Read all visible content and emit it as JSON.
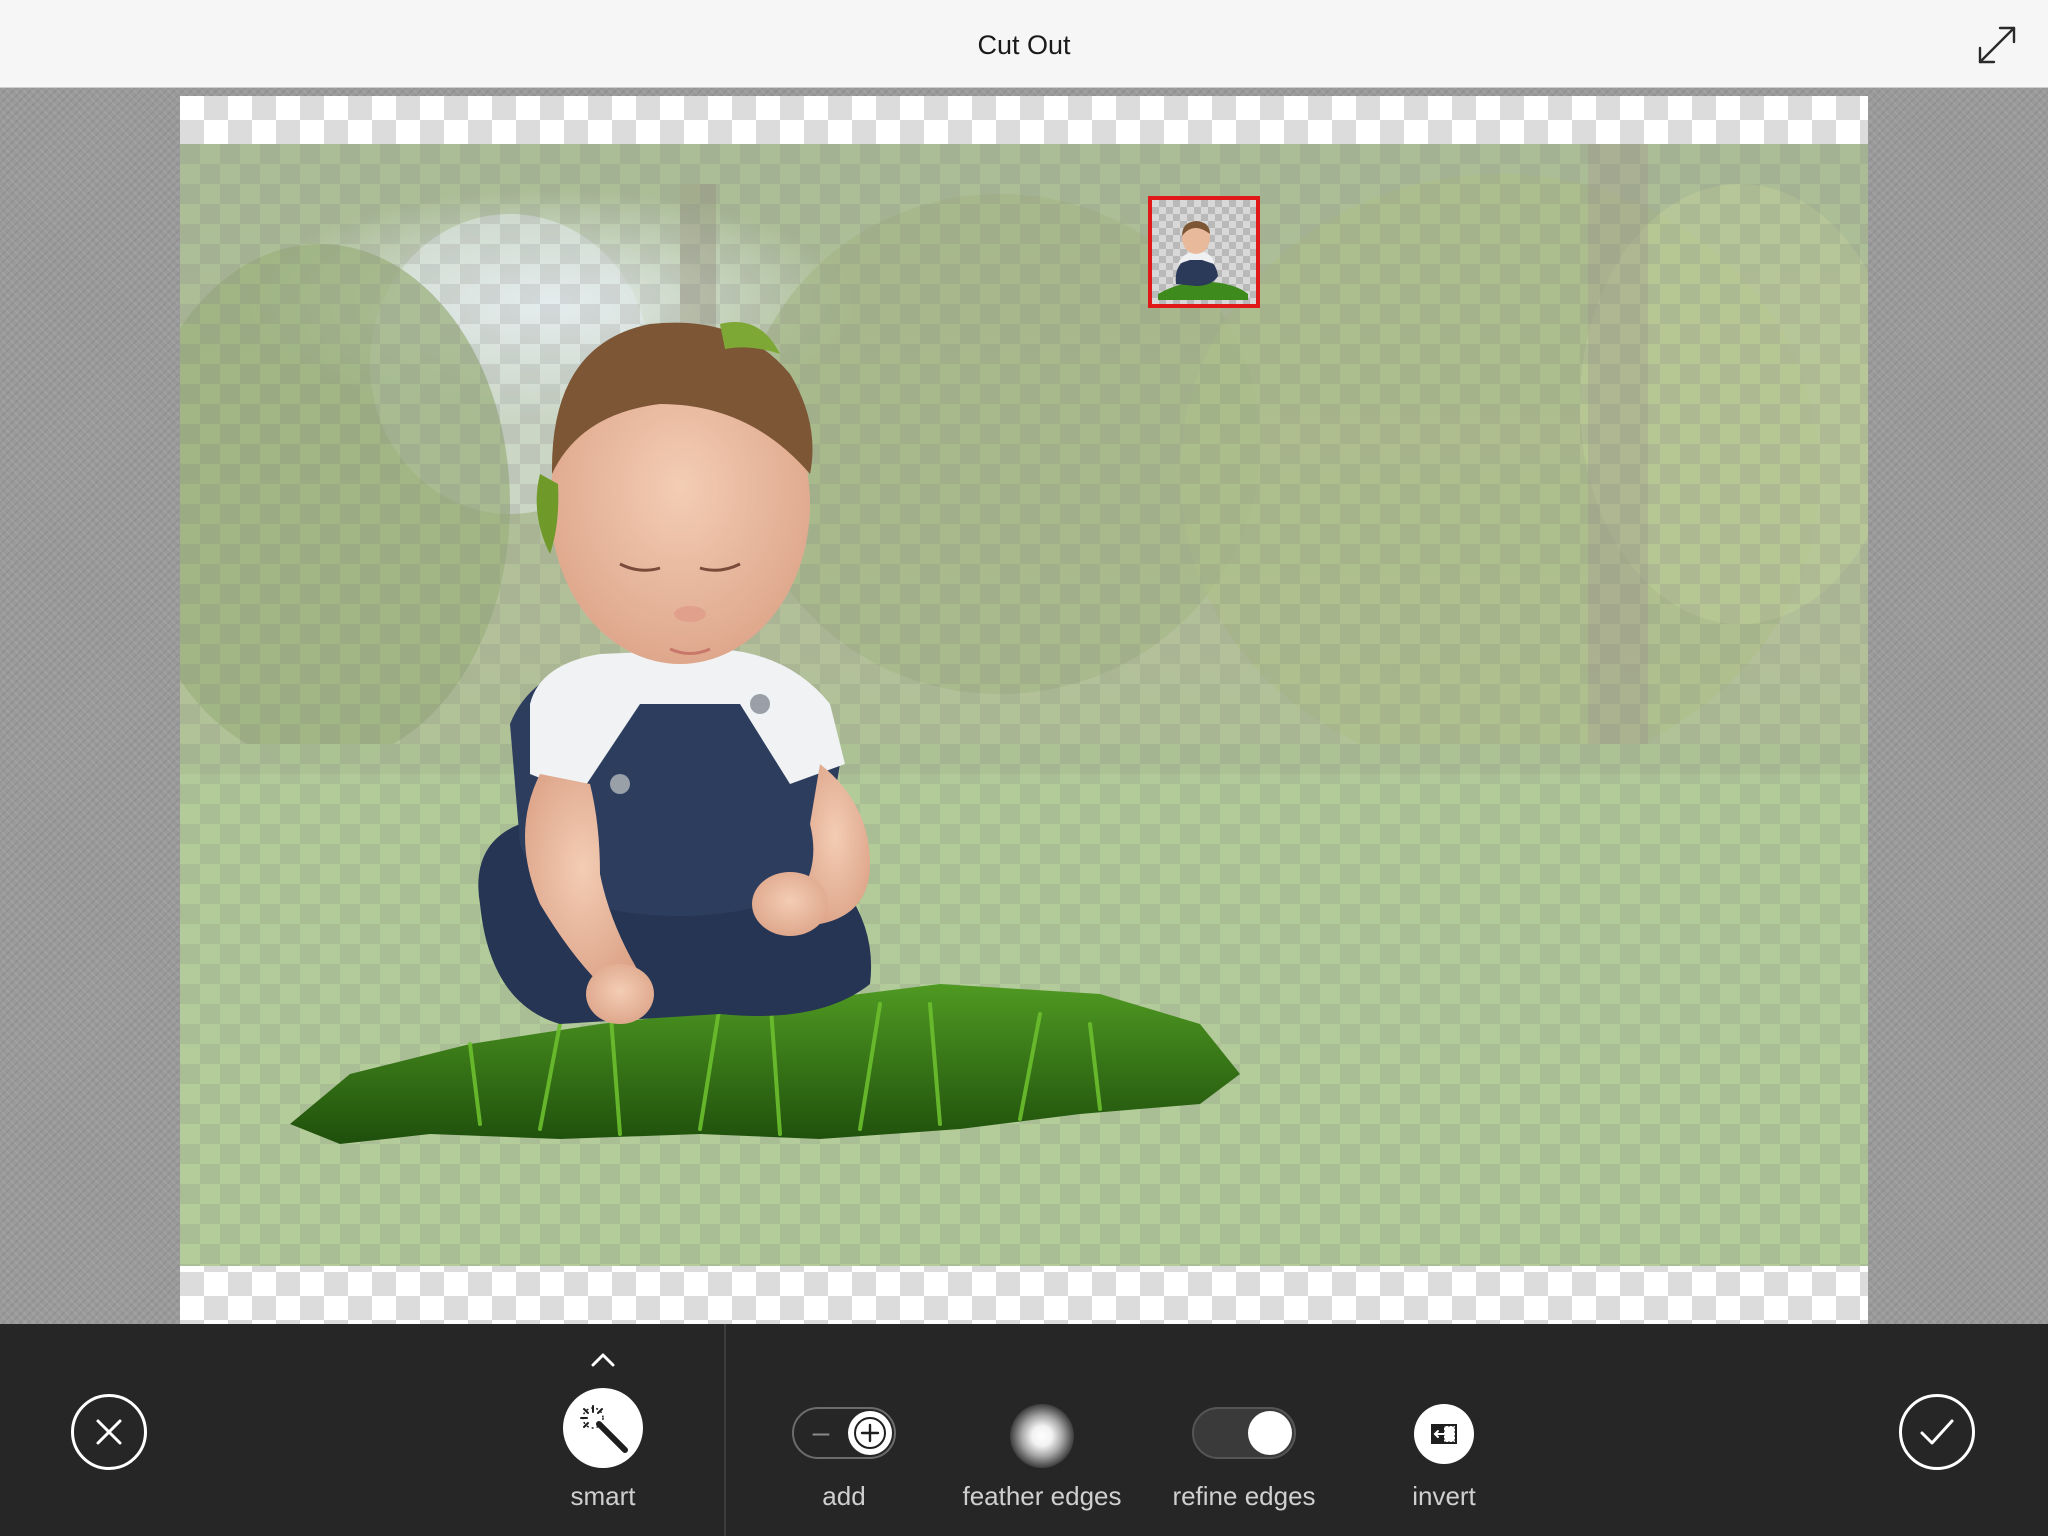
{
  "header": {
    "title": "Cut Out",
    "expand_icon": "expand-arrows-icon"
  },
  "canvas": {
    "background": "transparency-checkerboard",
    "thumbnail_border_color": "#e01818"
  },
  "toolbar": {
    "cancel_icon": "close-icon",
    "confirm_icon": "checkmark-icon",
    "tools": {
      "smart": {
        "label": "smart",
        "icon": "magic-wand-icon"
      },
      "add": {
        "label": "add",
        "minus_glyph": "–",
        "icon": "plus-icon"
      },
      "feather": {
        "label": "feather edges",
        "icon": "feather-glow-icon"
      },
      "refine": {
        "label": "refine edges",
        "enabled": true
      },
      "invert": {
        "label": "invert",
        "icon": "invert-selection-icon"
      }
    }
  },
  "colors": {
    "header_bg": "#f6f6f6",
    "toolbar_bg": "#262626",
    "workspace_bg": "#9a9a9a",
    "accent_red": "#e01818"
  }
}
